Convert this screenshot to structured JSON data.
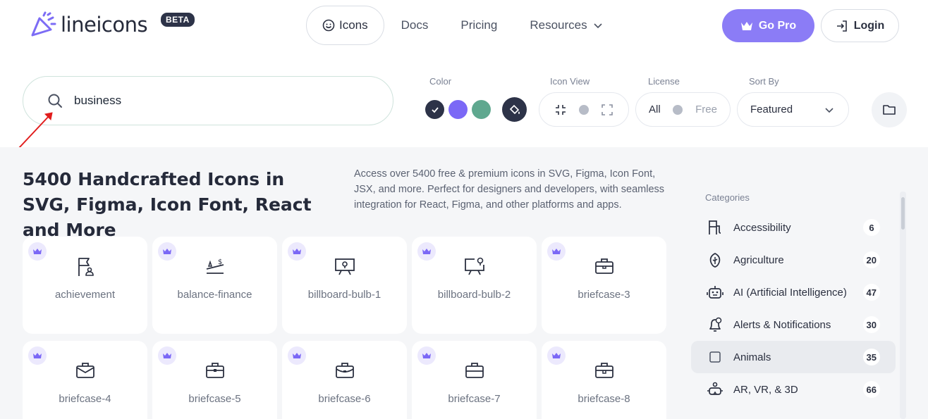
{
  "brand": {
    "name": "lineicons",
    "badge": "BETA",
    "color": "#7c6cf5"
  },
  "nav": {
    "icons_label": "Icons",
    "docs_label": "Docs",
    "pricing_label": "Pricing",
    "resources_label": "Resources",
    "go_pro_label": "Go Pro",
    "login_label": "Login"
  },
  "search": {
    "value": "business"
  },
  "filters": {
    "color_label": "Color",
    "swatches": [
      "#2d3348",
      "#7b68f6",
      "#5fa88f",
      "#2d3348"
    ],
    "icon_view_label": "Icon View",
    "license_label": "License",
    "license_all": "All",
    "license_free": "Free",
    "sort_label": "Sort By",
    "sort_value": "Featured"
  },
  "hero": {
    "title": "5400 Handcrafted Icons in SVG, Figma, Icon Font, React and More",
    "description": "Access over 5400 free & premium icons in SVG, Figma, Icon Font, JSX, and more. Perfect for designers and developers, with seamless integration for React, Figma, and other platforms and apps."
  },
  "icons": [
    {
      "name": "achievement",
      "icon": "flag-user-icon"
    },
    {
      "name": "balance-finance",
      "icon": "balance-icon"
    },
    {
      "name": "billboard-bulb-1",
      "icon": "billboard-icon"
    },
    {
      "name": "billboard-bulb-2",
      "icon": "billboard-2-icon"
    },
    {
      "name": "briefcase-3",
      "icon": "briefcase-icon"
    },
    {
      "name": "briefcase-4",
      "icon": "briefcase-icon"
    },
    {
      "name": "briefcase-5",
      "icon": "briefcase-icon"
    },
    {
      "name": "briefcase-6",
      "icon": "briefcase-icon"
    },
    {
      "name": "briefcase-7",
      "icon": "briefcase-icon"
    },
    {
      "name": "briefcase-8",
      "icon": "briefcase-icon"
    }
  ],
  "categories": {
    "title": "Categories",
    "items": [
      {
        "label": "Accessibility",
        "count": "6",
        "icon": "accessibility-icon"
      },
      {
        "label": "Agriculture",
        "count": "20",
        "icon": "agriculture-icon"
      },
      {
        "label": "AI (Artificial Intelligence)",
        "count": "47",
        "icon": "robot-icon"
      },
      {
        "label": "Alerts & Notifications",
        "count": "30",
        "icon": "bell-icon"
      },
      {
        "label": "Animals",
        "count": "35",
        "icon": "square-icon"
      },
      {
        "label": "AR, VR, & 3D",
        "count": "66",
        "icon": "vr-icon"
      }
    ]
  }
}
